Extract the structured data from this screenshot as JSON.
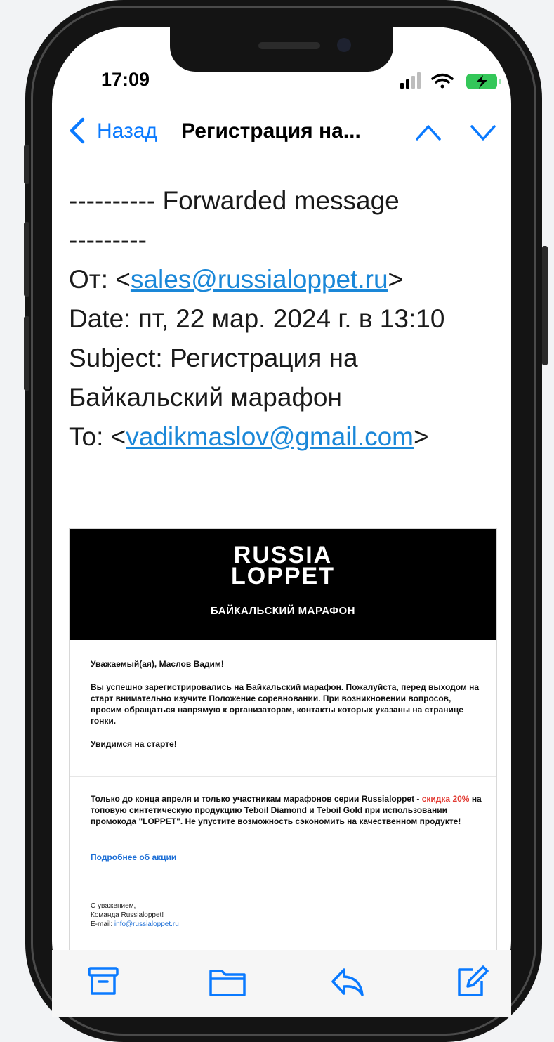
{
  "status": {
    "time": "17:09"
  },
  "nav": {
    "back_label": "Назад",
    "title": "Регистрация на..."
  },
  "forwarded": {
    "header_line1": "---------- Forwarded message",
    "header_line2": "---------",
    "from_label": "От: <",
    "from_email": "sales@russialoppet.ru",
    "from_close": ">",
    "date": "Date: пт, 22 мар. 2024 г. в 13:10",
    "subject_line1": "Subject: Регистрация на",
    "subject_line2": "Байкальский марафон",
    "to_label": "To: <",
    "to_email": "vadikmaslov@gmail.com",
    "to_close": ">"
  },
  "email": {
    "logo_line1": "RUSSIA",
    "logo_line2": "LOPPET",
    "brand_subtitle": "БАЙКАЛЬСКИЙ МАРАФОН",
    "greeting": "Уважаемый(ая), Маслов Вадим!",
    "body": "Вы успешно зарегистрировались на Байкальский марафон. Пожалуйста, перед выходом на старт внимательно изучите Положение соревновании. При возникновении вопросов, просим обращаться напрямую к организаторам, контакты которых указаны на странице гонки.",
    "see_you": "Увидимся на старте!",
    "promo_before": "Только до конца апреля и только участникам марафонов серии Russialoppet -",
    "promo_highlight": "скидка 20%",
    "promo_after": "на топовую синтетическую продукцию Teboil Diamond и Teboil Gold при использовании промокода \"LOPPET\". Не упустите возможность сэкономить на качественном продукте!",
    "promo_link": "Подробнее об акции",
    "sign_line1": "С уважением,",
    "sign_line2": "Команда Russialoppet!",
    "sign_email_label": "E-mail:",
    "sign_email": "info@russialoppet.ru"
  },
  "colors": {
    "link": "#1a87d8",
    "ios_blue": "#0a7aff",
    "promo_red": "#e23a32"
  },
  "toolbar_icons": [
    "archive-icon",
    "folder-icon",
    "reply-icon",
    "compose-icon"
  ]
}
